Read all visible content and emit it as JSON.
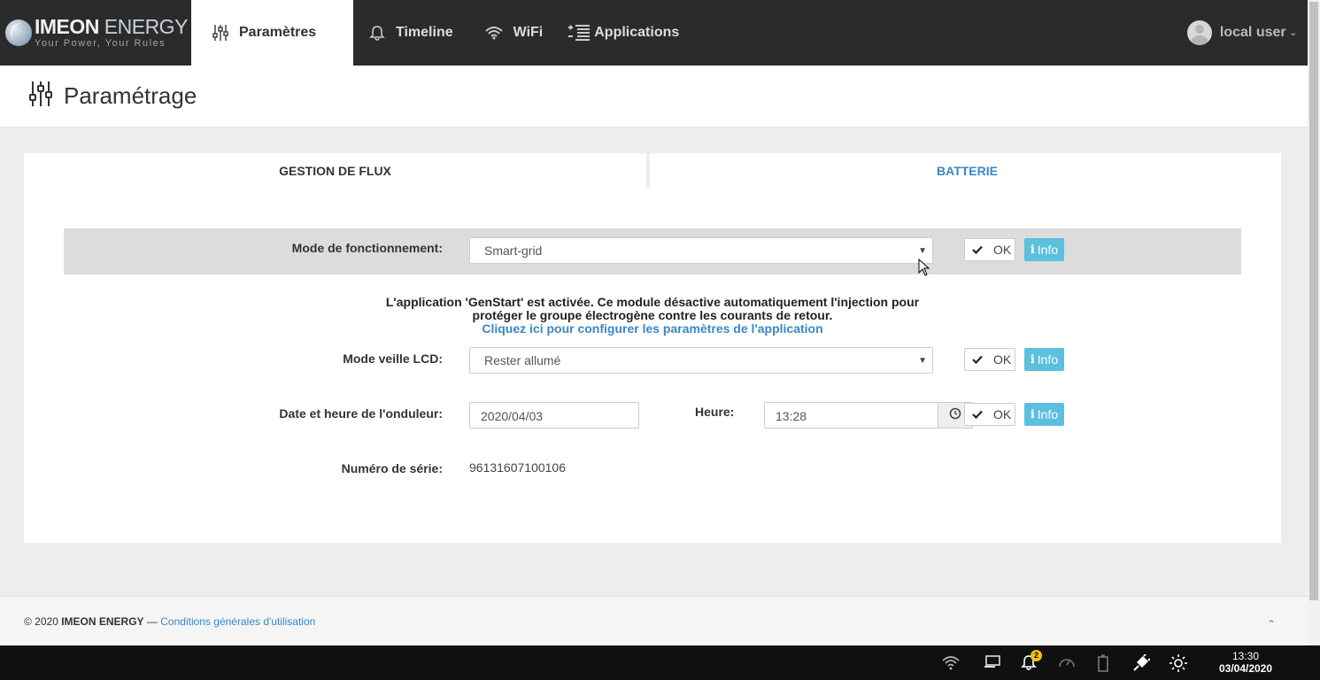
{
  "brand": {
    "name_bold": "IMEON",
    "name_light": " ENERGY",
    "tagline": "Your Power, Your Rules"
  },
  "nav": {
    "items": [
      {
        "label": "Paramètres",
        "icon": "sliders-icon"
      },
      {
        "label": "Timeline",
        "icon": "bell-icon"
      },
      {
        "label": "WiFi",
        "icon": "wifi-icon"
      },
      {
        "label": "Applications",
        "icon": "apps-list-icon"
      }
    ],
    "user": "local user"
  },
  "page": {
    "title": "Paramétrage"
  },
  "tabs": [
    "GESTION DE FLUX",
    "BATTERIE"
  ],
  "form": {
    "mode": {
      "label": "Mode de fonctionnement:",
      "value": "Smart-grid"
    },
    "notice": {
      "line1": "L'application 'GenStart' est activée. Ce module désactive automatiquement l'injection pour",
      "line2": "protéger le groupe électrogène contre les courants de retour.",
      "link": "Cliquez ici pour configurer les paramètres de l'application"
    },
    "lcd": {
      "label": "Mode veille LCD:",
      "value": "Rester allumé"
    },
    "datetime": {
      "label": "Date et heure de l'onduleur:",
      "date": "2020/04/03",
      "time_label": "Heure:",
      "time": "13:28"
    },
    "serial": {
      "label": "Numéro de série:",
      "value": "96131607100106"
    },
    "ok_label": "OK",
    "info_label": "Info"
  },
  "footer": {
    "copyright": "© 2020 ",
    "company": "IMEON ENERGY",
    "sep": " — ",
    "link": "Conditions générales d'utilisation"
  },
  "taskbar": {
    "notifications": "2",
    "time": "13:30",
    "date": "03/04/2020"
  },
  "colors": {
    "navbar": "#2b2b2b",
    "link": "#3a87c6",
    "info": "#5bc0de",
    "highlight_row": "#dcdcdc"
  }
}
